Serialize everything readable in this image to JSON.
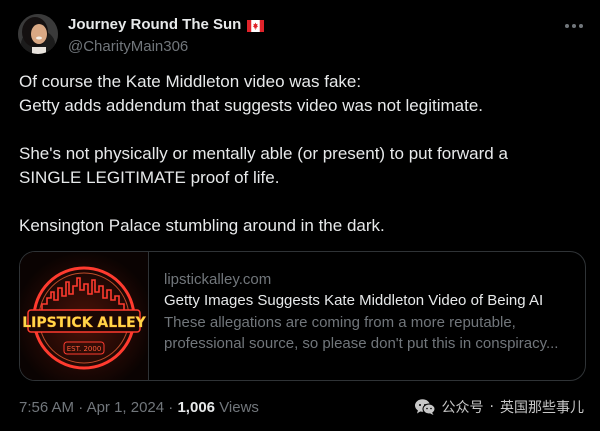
{
  "author": {
    "display_name": "Journey Round The Sun",
    "flag_icon": "canada-flag-icon",
    "handle": "@CharityMain306",
    "avatar_icon": "profile-avatar"
  },
  "tweet": {
    "line1": "Of course the Kate Middleton video was fake:",
    "line2": "Getty adds addendum that suggests video was not legitimate.",
    "line3": "She's not physically or mentally able (or present) to put forward a",
    "line4": "SINGLE LEGITIMATE proof of life.",
    "line5": "Kensington Palace stumbling around in the dark."
  },
  "card": {
    "domain": "lipstickalley.com",
    "title": "Getty Images Suggests Kate Middleton Video of Being AI",
    "description": "These allegations are coming from a more reputable, professional source, so please don't put this in conspiracy...",
    "thumbnail": {
      "logo_text": "LIPSTICK ALLEY",
      "est_text": "EST. 2000"
    }
  },
  "meta": {
    "time": "7:56 AM",
    "dot": "·",
    "date": "Apr 1, 2024",
    "views_count": "1,006",
    "views_label": "Views"
  },
  "watermark": {
    "icon": "wechat-icon",
    "label": "公众号",
    "separator": "·",
    "account": "英国那些事儿"
  },
  "colors": {
    "background": "#000000",
    "text_primary": "#e7e9ea",
    "text_secondary": "#71767b",
    "border": "#2f3336",
    "neon_red": "#ff3b2f",
    "neon_yellow": "#ffd84a"
  }
}
